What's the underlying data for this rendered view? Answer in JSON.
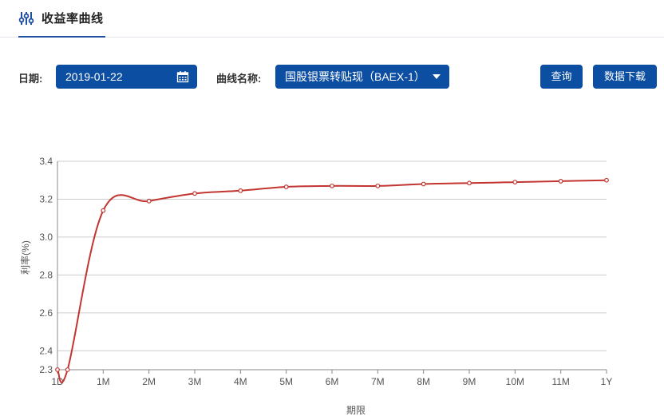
{
  "header": {
    "title": "收益率曲线",
    "icon": "sliders-icon"
  },
  "filters": {
    "date_label": "日期:",
    "date_value": "2019-01-22",
    "date_icon": "calendar-icon",
    "curve_label": "曲线名称:",
    "curve_value": "国股银票转贴现（BAEX-1）",
    "curve_icon": "caret-down-icon"
  },
  "buttons": {
    "query": "查询",
    "download": "数据下载"
  },
  "colors": {
    "accent": "#0b4ea2",
    "series_line": "#c23531",
    "grid": "#cccccc"
  },
  "chart_data": {
    "type": "line",
    "xlabel": "期限",
    "ylabel": "利率(%)",
    "categories": [
      "1D",
      "1M",
      "2M",
      "3M",
      "4M",
      "5M",
      "6M",
      "7M",
      "8M",
      "9M",
      "10M",
      "11M",
      "1Y"
    ],
    "x_points": [
      "1D",
      "",
      "1M",
      "2M",
      "3M",
      "4M",
      "5M",
      "6M",
      "7M",
      "8M",
      "9M",
      "10M",
      "11M",
      "1Y"
    ],
    "values": [
      2.3,
      2.3,
      3.14,
      3.19,
      3.23,
      3.245,
      3.265,
      3.27,
      3.27,
      3.28,
      3.285,
      3.29,
      3.295,
      3.3
    ],
    "yticks": [
      2.3,
      2.4,
      2.6,
      2.8,
      3.0,
      3.2,
      3.4
    ],
    "ylim": [
      2.3,
      3.4
    ],
    "grid": true,
    "legend": false
  }
}
